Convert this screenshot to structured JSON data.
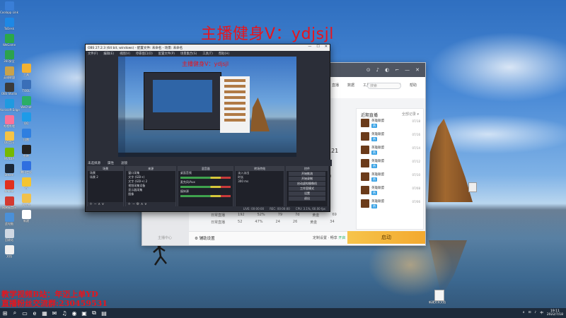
{
  "overlay": {
    "anchor_title": "主播健身V：ydjsjl",
    "promo_line1": "教学视频B站：年迈上单YD",
    "promo_line2": "直播粉丝交流群:230459531"
  },
  "desktop": {
    "left_icons": [
      {
        "label": "Coolapp Link",
        "icon": "app-icon",
        "color": "#3a7ed6"
      },
      {
        "label": "ToDesk",
        "icon": "app-icon",
        "color": "#1e88e5"
      },
      {
        "label": "WeGame",
        "icon": "app-icon",
        "color": "#2ba84a"
      },
      {
        "label": "360安全",
        "icon": "app-icon",
        "color": "#2ca24d"
      },
      {
        "label": "英雄联盟",
        "icon": "app-icon",
        "color": "#c8a24b"
      },
      {
        "label": "OBS Studio",
        "icon": "app-icon",
        "color": "#3b3b3b"
      },
      {
        "label": "Microsoft Edge",
        "icon": "edge-icon",
        "color": "#1f9ae0"
      },
      {
        "label": "哔哩哔哩",
        "icon": "app-icon",
        "color": "#fb7299"
      },
      {
        "label": "QQ音乐",
        "icon": "app-icon",
        "color": "#f6c344"
      },
      {
        "label": "NVIDIA",
        "icon": "app-icon",
        "color": "#76b900"
      },
      {
        "label": "Steam",
        "icon": "steam-icon",
        "color": "#1b2838"
      },
      {
        "label": "Adobe",
        "icon": "app-icon",
        "color": "#e0301e"
      },
      {
        "label": "网易云音乐",
        "icon": "app-icon",
        "color": "#d33a31"
      },
      {
        "label": "此电脑",
        "icon": "pc-icon",
        "color": "#4a90d9"
      },
      {
        "label": "回收站",
        "icon": "trash-icon",
        "color": "#cfd8e3"
      },
      {
        "label": "文档",
        "icon": "doc-icon",
        "color": "#f0f0f0"
      }
    ],
    "second_icons": [
      {
        "label": "工具",
        "icon": "app-icon",
        "color": "#f3b233"
      },
      {
        "label": "TOOL",
        "icon": "app-icon",
        "color": "#3a6fb8"
      },
      {
        "label": "WeChat",
        "icon": "app-icon",
        "color": "#2aae67"
      },
      {
        "label": "QQ",
        "icon": "app-icon",
        "color": "#1e9be8"
      },
      {
        "label": "迅雷",
        "icon": "app-icon",
        "color": "#2f7fe0"
      },
      {
        "label": "剪映",
        "icon": "app-icon",
        "color": "#222222"
      },
      {
        "label": "腾讯会议",
        "icon": "app-icon",
        "color": "#2f6fe0"
      },
      {
        "label": "YY",
        "icon": "app-icon",
        "color": "#f4c430"
      },
      {
        "label": "文件夹",
        "icon": "folder-icon",
        "color": "#f1c14b"
      },
      {
        "label": "新建",
        "icon": "doc-icon",
        "color": "#ffffff"
      }
    ],
    "file_label": "新建文本文档"
  },
  "obs": {
    "title": "OBS 27.2.3 (64 bit, windows) - 配置文件: 未命名 - 场景: 未命名",
    "menu": [
      "文件(F)",
      "编辑(E)",
      "视图(V)",
      "停靠窗口(D)",
      "配置文件(P)",
      "场景集合(S)",
      "工具(T)",
      "帮助(H)"
    ],
    "window_controls": [
      "—",
      "☐",
      "✕"
    ],
    "scene_bar": [
      "未选择源",
      "属性",
      "滤镜"
    ],
    "docks": {
      "scenes": {
        "header": "场景",
        "items": [
          "场景",
          "场景 2"
        ]
      },
      "sources": {
        "header": "来源",
        "items": [
          "窗口采集",
          "文字 (GDI+)",
          "文字 (GDI+) 2",
          "视频采集设备",
          "显示器采集",
          "图像"
        ]
      },
      "mixer": {
        "header": "混音器",
        "items": [
          "桌面音频",
          "麦克风/Aux",
          "媒体源"
        ]
      },
      "transitions": {
        "header": "转场特效",
        "items": [
          "淡入淡出",
          "时长",
          "300 ms"
        ]
      },
      "controls": {
        "header": "控件",
        "items": [
          "开始推流",
          "开始录制",
          "启动虚拟摄像机",
          "工作室模式",
          "设置",
          "退出"
        ]
      }
    },
    "status": [
      "LIVE: 00:00:00",
      "REC: 00:00:00",
      "CPU: 3.1%, 60.00 fps"
    ]
  },
  "live_app": {
    "top_icons": [
      "⊙",
      "♪",
      "◐",
      "⌐",
      "—",
      "✕"
    ],
    "nav_tabs": [
      "直播",
      "数据",
      "工具",
      "任务",
      "粉丝",
      "帮助"
    ],
    "search_placeholder": "搜索",
    "recent_title": "近期直播",
    "recent_more": "全部记录 ▾",
    "recent_rows": [
      {
        "name": "英雄联盟",
        "tag": "热",
        "time": "07/18"
      },
      {
        "name": "英雄联盟",
        "tag": "热",
        "time": "07/16"
      },
      {
        "name": "英雄联盟",
        "tag": "热",
        "time": "07/14"
      },
      {
        "name": "英雄联盟",
        "tag": "热",
        "time": "07/12"
      },
      {
        "name": "英雄联盟",
        "tag": "热",
        "time": "07/10"
      },
      {
        "name": "英雄联盟",
        "tag": "热",
        "time": "07/08"
      },
      {
        "name": "英雄联盟",
        "tag": "热",
        "time": "07/06"
      }
    ],
    "stats": [
      "121",
      "0",
      "0"
    ],
    "table_rows": [
      [
        "日常直播",
        "192",
        "52%",
        "79",
        "7d",
        "黄金",
        "69"
      ],
      [
        "日常直播",
        "52",
        "47%",
        "24",
        "26",
        "黄金",
        "34"
      ]
    ],
    "settings_label": "⚙ 辅助设置",
    "mode_label": "定制设置 · 畅享",
    "mode_badge": "开启",
    "start_button": "启动",
    "side_label": "主播中心"
  },
  "taskbar": {
    "apps": [
      "⊞",
      "⌕",
      "▭",
      "e",
      "▦",
      "✉",
      "♫",
      "◉",
      "▣",
      "⧉",
      "▤"
    ],
    "tray": [
      "∧",
      "⊡",
      "♪",
      "中"
    ],
    "time": "19:11",
    "date": "2022/7/18"
  }
}
